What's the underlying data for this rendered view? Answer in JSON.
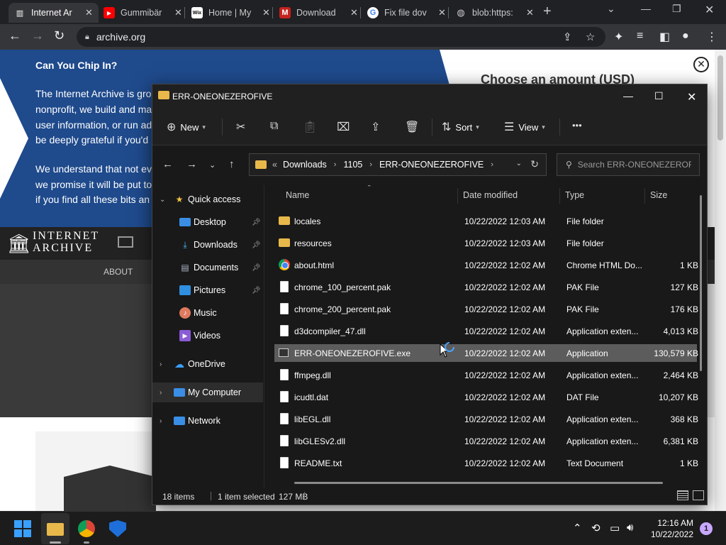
{
  "browser": {
    "tabs": [
      {
        "title": "Internet Ar",
        "icon": "archive-icon"
      },
      {
        "title": "Gummibär",
        "icon": "youtube-icon"
      },
      {
        "title": "Home | My",
        "icon": "wix-icon"
      },
      {
        "title": "Download",
        "icon": "gmail-icon"
      },
      {
        "title": "Fix file dov",
        "icon": "google-icon"
      },
      {
        "title": "blob:https:",
        "icon": "globe-icon"
      }
    ],
    "url": "archive.org"
  },
  "webpage": {
    "heading": "Can You Chip In?",
    "lines": [
      "The Internet Archive is gro",
      "nonprofit, we build and ma",
      "user information, or run ad",
      "be deeply grateful if you'd",
      "We understand that not ev",
      "we promise it will be put to",
      "if you find all these bits an"
    ],
    "choose_amount": "Choose an amount (USD)",
    "logo_line1": "INTERNET",
    "logo_line2": "ARCHIVE",
    "nav_about": "ABOUT"
  },
  "explorer": {
    "title": "ERR-ONEONEZEROFIVE",
    "commands": {
      "new": "New",
      "sort": "Sort",
      "view": "View",
      "more": "•••"
    },
    "breadcrumbs": [
      "Downloads",
      "1105",
      "ERR-ONEONEZEROFIVE"
    ],
    "breadcrumb_prefix": "«",
    "search_placeholder": "Search ERR-ONEONEZEROFI...",
    "nav": {
      "quick_access": "Quick access",
      "desktop": "Desktop",
      "downloads": "Downloads",
      "documents": "Documents",
      "pictures": "Pictures",
      "music": "Music",
      "videos": "Videos",
      "onedrive": "OneDrive",
      "my_computer": "My Computer",
      "network": "Network"
    },
    "columns": {
      "name": "Name",
      "date": "Date modified",
      "type": "Type",
      "size": "Size"
    },
    "files": [
      {
        "name": "locales",
        "date": "10/22/2022 12:03 AM",
        "type": "File folder",
        "size": "",
        "icon": "folder"
      },
      {
        "name": "resources",
        "date": "10/22/2022 12:03 AM",
        "type": "File folder",
        "size": "",
        "icon": "folder"
      },
      {
        "name": "about.html",
        "date": "10/22/2022 12:02 AM",
        "type": "Chrome HTML Do...",
        "size": "1 KB",
        "icon": "chrome"
      },
      {
        "name": "chrome_100_percent.pak",
        "date": "10/22/2022 12:02 AM",
        "type": "PAK File",
        "size": "127 KB",
        "icon": "doc"
      },
      {
        "name": "chrome_200_percent.pak",
        "date": "10/22/2022 12:02 AM",
        "type": "PAK File",
        "size": "176 KB",
        "icon": "doc"
      },
      {
        "name": "d3dcompiler_47.dll",
        "date": "10/22/2022 12:02 AM",
        "type": "Application exten...",
        "size": "4,013 KB",
        "icon": "doc"
      },
      {
        "name": "ERR-ONEONEZEROFIVE.exe",
        "date": "10/22/2022 12:02 AM",
        "type": "Application",
        "size": "130,579 KB",
        "icon": "exe"
      },
      {
        "name": "ffmpeg.dll",
        "date": "10/22/2022 12:02 AM",
        "type": "Application exten...",
        "size": "2,464 KB",
        "icon": "doc"
      },
      {
        "name": "icudtl.dat",
        "date": "10/22/2022 12:02 AM",
        "type": "DAT File",
        "size": "10,207 KB",
        "icon": "doc"
      },
      {
        "name": "libEGL.dll",
        "date": "10/22/2022 12:02 AM",
        "type": "Application exten...",
        "size": "368 KB",
        "icon": "doc"
      },
      {
        "name": "libGLESv2.dll",
        "date": "10/22/2022 12:02 AM",
        "type": "Application exten...",
        "size": "6,381 KB",
        "icon": "doc"
      },
      {
        "name": "README.txt",
        "date": "10/22/2022 12:02 AM",
        "type": "Text Document",
        "size": "1 KB",
        "icon": "doc"
      }
    ],
    "status": {
      "items": "18 items",
      "selected": "1 item selected",
      "selected_size": "127 MB"
    }
  },
  "taskbar": {
    "time": "12:16 AM",
    "date": "10/22/2022",
    "notification_count": "1"
  }
}
